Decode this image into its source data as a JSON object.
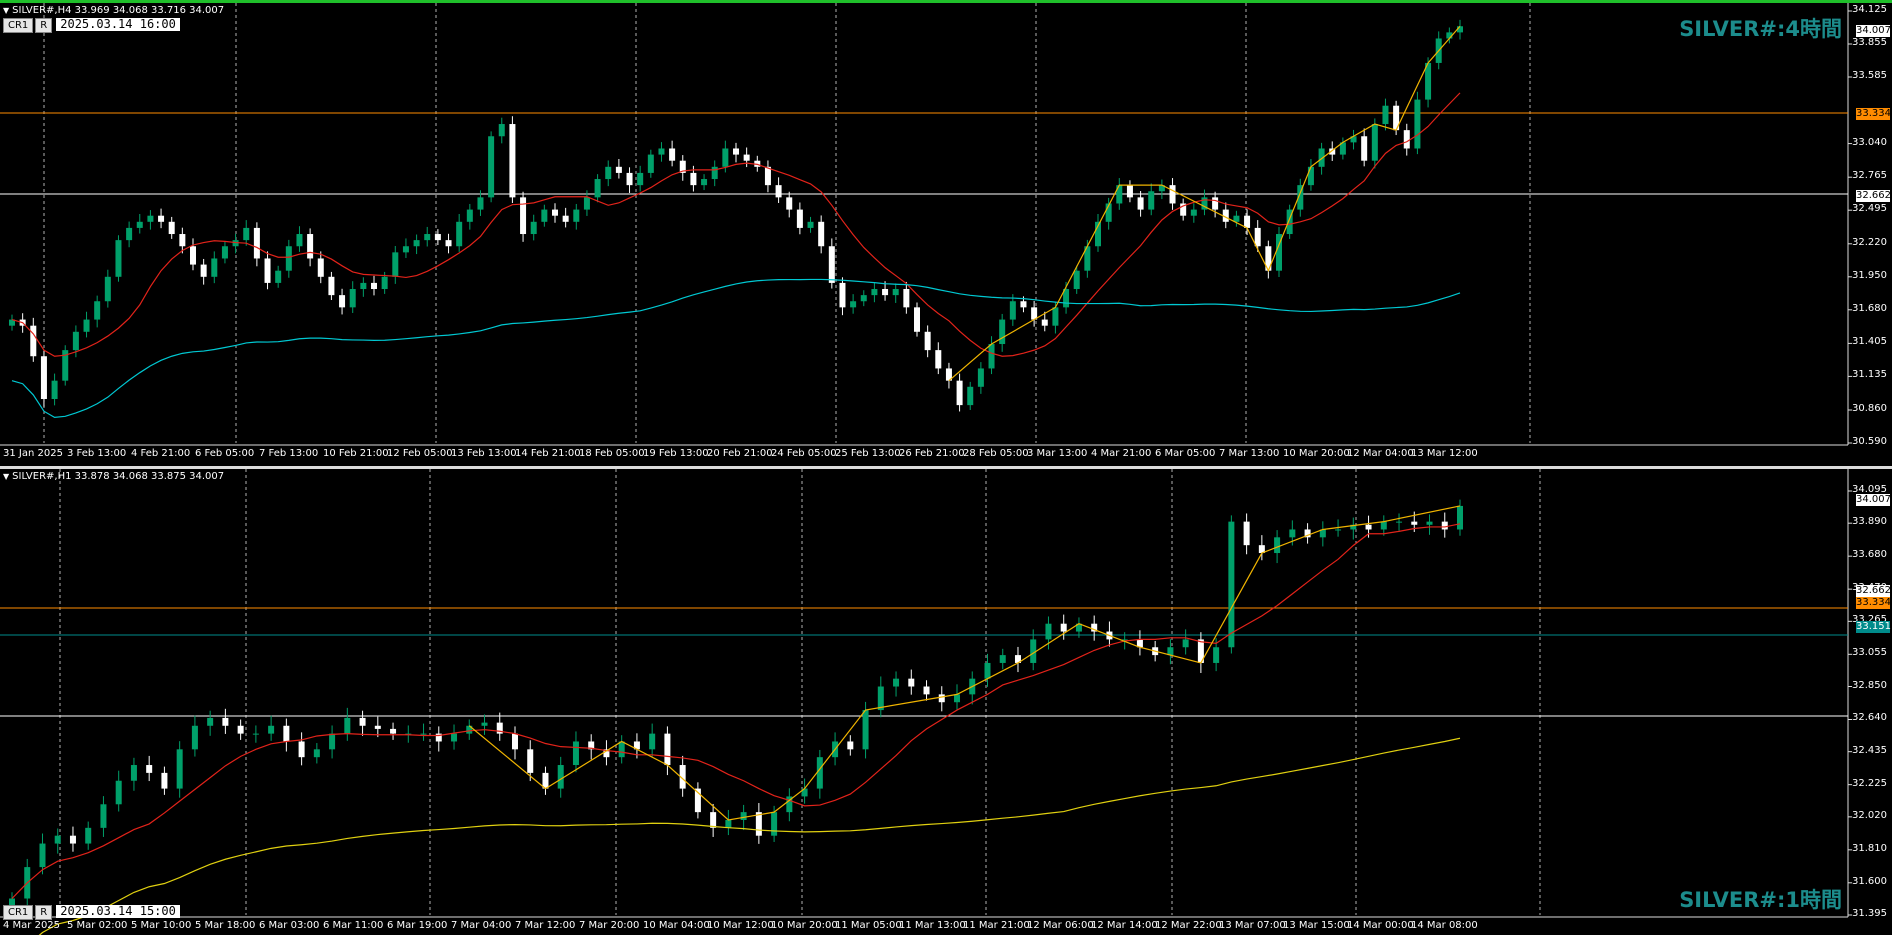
{
  "colors": {
    "candle_up": "#00a06a",
    "candle_down": "#ffffff",
    "ma_red": "#e2231a",
    "ma_cyan": "#00c8d2",
    "ma_yellow": "#e0d010",
    "zigzag": "#f0b400",
    "level_orange": "#ff8c00",
    "level_white": "#ffffff",
    "level_teal": "#008b8b",
    "grid": "#b0b0b0",
    "label": "#1c8c8c"
  },
  "top": {
    "info": "SILVER#,H4  33.969 34.068 33.716 34.007",
    "badge_cr": "CR1",
    "badge_r": "R",
    "datetime": "2025.03.14 16:00",
    "corner_label": "SILVER#:4時間",
    "y_labels": [
      "34.125",
      "33.855",
      "33.585",
      "33.040",
      "32.765",
      "32.495",
      "32.220",
      "31.950",
      "31.680",
      "31.405",
      "31.135",
      "30.860",
      "30.590"
    ],
    "price_tags": {
      "last": "34.007",
      "orange": "33.334",
      "white": "32.662"
    },
    "x_labels": [
      "31 Jan 2025",
      "3 Feb 13:00",
      "4 Feb 21:00",
      "6 Feb 05:00",
      "7 Feb 13:00",
      "10 Feb 21:00",
      "12 Feb 05:00",
      "13 Feb 13:00",
      "14 Feb 21:00",
      "18 Feb 05:00",
      "19 Feb 13:00",
      "20 Feb 21:00",
      "24 Feb 05:00",
      "25 Feb 13:00",
      "26 Feb 21:00",
      "28 Feb 05:00",
      "3 Mar 13:00",
      "4 Mar 21:00",
      "6 Mar 05:00",
      "7 Mar 13:00",
      "10 Mar 20:00",
      "12 Mar 04:00",
      "13 Mar 12:00"
    ]
  },
  "bottom": {
    "info": "SILVER#,H1  33.878 34.068 33.875 34.007",
    "badge_cr": "CR1",
    "badge_r": "R",
    "datetime": "2025.03.14 15:00",
    "corner_label": "SILVER#:1時間",
    "y_labels": [
      "34.095",
      "33.890",
      "33.680",
      "33.470",
      "33.265",
      "33.055",
      "32.850",
      "32.640",
      "32.435",
      "32.225",
      "32.020",
      "31.810",
      "31.600",
      "31.395"
    ],
    "price_tags": {
      "last": "34.007",
      "orange": "33.334",
      "teal": "33.151",
      "white": "32.662"
    },
    "x_labels": [
      "4 Mar 2025",
      "5 Mar 02:00",
      "5 Mar 10:00",
      "5 Mar 18:00",
      "6 Mar 03:00",
      "6 Mar 11:00",
      "6 Mar 19:00",
      "7 Mar 04:00",
      "7 Mar 12:00",
      "7 Mar 20:00",
      "10 Mar 04:00",
      "10 Mar 12:00",
      "10 Mar 20:00",
      "11 Mar 05:00",
      "11 Mar 13:00",
      "11 Mar 21:00",
      "12 Mar 06:00",
      "12 Mar 14:00",
      "12 Mar 22:00",
      "13 Mar 07:00",
      "13 Mar 15:00",
      "14 Mar 00:00",
      "14 Mar 08:00"
    ]
  },
  "top_series": [
    31.6,
    31.55,
    31.3,
    30.95,
    31.1,
    31.35,
    31.5,
    31.6,
    31.75,
    31.95,
    32.25,
    32.35,
    32.4,
    32.45,
    32.4,
    32.3,
    32.2,
    32.05,
    31.95,
    32.1,
    32.2,
    32.25,
    32.35,
    32.1,
    31.9,
    32.0,
    32.2,
    32.3,
    32.1,
    31.95,
    31.8,
    31.7,
    31.85,
    31.9,
    31.85,
    31.95,
    32.15,
    32.2,
    32.25,
    32.3,
    32.25,
    32.2,
    32.4,
    32.5,
    32.6,
    33.1,
    33.2,
    32.6,
    32.3,
    32.4,
    32.5,
    32.45,
    32.4,
    32.5,
    32.6,
    32.75,
    32.85,
    32.8,
    32.7,
    32.8,
    32.95,
    33.0,
    32.9,
    32.8,
    32.7,
    32.75,
    32.85,
    33.0,
    32.95,
    32.9,
    32.85,
    32.7,
    32.6,
    32.5,
    32.35,
    32.4,
    32.2,
    31.9,
    31.7,
    31.75,
    31.8,
    31.85,
    31.8,
    31.85,
    31.7,
    31.5,
    31.35,
    31.2,
    31.1,
    30.9,
    31.05,
    31.2,
    31.4,
    31.6,
    31.75,
    31.7,
    31.6,
    31.55,
    31.7,
    31.85,
    32.0,
    32.2,
    32.4,
    32.55,
    32.7,
    32.6,
    32.5,
    32.65,
    32.7,
    32.55,
    32.45,
    32.5,
    32.6,
    32.5,
    32.4,
    32.45,
    32.35,
    32.2,
    32.0,
    32.3,
    32.5,
    32.7,
    32.85,
    33.0,
    32.95,
    33.05,
    33.1,
    32.9,
    33.2,
    33.35,
    33.15,
    33.0,
    33.4,
    33.7,
    33.9,
    33.95,
    34.0
  ],
  "bottom_series": [
    31.5,
    31.7,
    31.85,
    31.9,
    31.85,
    31.95,
    32.1,
    32.25,
    32.35,
    32.3,
    32.2,
    32.45,
    32.6,
    32.65,
    32.6,
    32.55,
    32.55,
    32.6,
    32.5,
    32.4,
    32.45,
    32.55,
    32.65,
    32.6,
    32.58,
    32.55,
    32.55,
    32.55,
    32.5,
    32.55,
    32.6,
    32.62,
    32.55,
    32.45,
    32.3,
    32.2,
    32.35,
    32.5,
    32.45,
    32.4,
    32.5,
    32.45,
    32.55,
    32.35,
    32.2,
    32.05,
    31.95,
    32.0,
    32.05,
    31.9,
    32.05,
    32.15,
    32.2,
    32.4,
    32.5,
    32.45,
    32.7,
    32.85,
    32.9,
    32.85,
    32.8,
    32.75,
    32.8,
    32.9,
    33.0,
    33.05,
    33.0,
    33.15,
    33.25,
    33.2,
    33.25,
    33.2,
    33.15,
    33.15,
    33.1,
    33.05,
    33.1,
    33.15,
    33.0,
    33.1,
    33.9,
    33.75,
    33.7,
    33.8,
    33.85,
    33.8,
    33.85,
    33.85,
    33.88,
    33.85,
    33.9,
    33.9,
    33.88,
    33.9,
    33.85,
    34.0
  ]
}
